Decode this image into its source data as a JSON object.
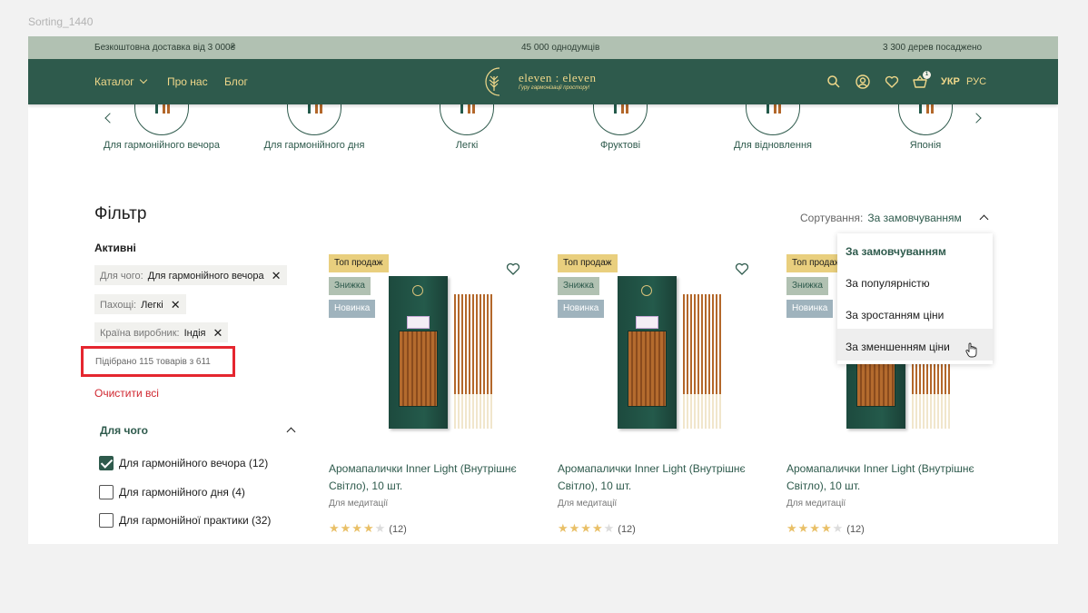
{
  "frame_label": "Sorting_1440",
  "topbar": {
    "left": "Безкоштовна доставка від 3 000₴",
    "center": "45 000 однодумців",
    "right": "3 300 дерев посаджено"
  },
  "nav": {
    "catalog": "Каталог",
    "about": "Про нас",
    "blog": "Блог",
    "logo_text": "eleven : eleven",
    "logo_tagline": "Гуру гармонізації простору!",
    "cart_count": "1",
    "lang_active": "УКР",
    "lang_other": "РУС"
  },
  "categories": [
    "Для гармонійного вечора",
    "Для гармонійного дня",
    "Легкі",
    "Фруктові",
    "Для відновлення",
    "Японія"
  ],
  "filter": {
    "title": "Фільтр",
    "active_title": "Активні",
    "chips": [
      {
        "key": "Для чого:",
        "value": "Для гармонійного вечора"
      },
      {
        "key": "Пахощі:",
        "value": "Легкі"
      },
      {
        "key": "Країна виробник:",
        "value": "Індія"
      }
    ],
    "found": "Підібрано 115 товарів з 611",
    "clear_all": "Очистити всі",
    "group_title": "Для чого",
    "options": [
      {
        "label": "Для гармонійного вечора (12)",
        "checked": true
      },
      {
        "label": "Для гармонійного дня (4)",
        "checked": false
      },
      {
        "label": "Для гармонійної практики (32)",
        "checked": false
      }
    ]
  },
  "sort": {
    "label": "Сортування:",
    "value": "За замовчуванням",
    "options": [
      "За замовчуванням",
      "За популярністю",
      "За зростанням ціни",
      "За зменшенням ціни"
    ]
  },
  "products": [
    {
      "badges": [
        "Топ продаж",
        "Знижка",
        "Новинка"
      ],
      "name": "Аромапалички Inner Light (Внутрішнє Світло), 10 шт.",
      "subtitle": "Для медитації",
      "rating": 4,
      "reviews": "(12)"
    },
    {
      "badges": [
        "Топ продаж",
        "Знижка",
        "Новинка"
      ],
      "name": "Аромапалички Inner Light (Внутрішнє Світло), 10 шт.",
      "subtitle": "Для медитації",
      "rating": 4,
      "reviews": "(12)"
    },
    {
      "badges": [
        "Топ продаж",
        "Знижка",
        "Новинка"
      ],
      "name": "Аромапалички Inner Light (Внутрішнє Світло), 10 шт.",
      "subtitle": "Для медитації",
      "rating": 4,
      "reviews": "(12)"
    }
  ],
  "colors": {
    "brand_green": "#2e5a4c",
    "brand_gold": "#f0d88a",
    "topbar_bg": "#b1c1b2",
    "badge_top": "#e9cf7e",
    "badge_sale": "#b1c1b2",
    "badge_new": "#9fb3bd",
    "highlight_red": "#e5262f"
  }
}
